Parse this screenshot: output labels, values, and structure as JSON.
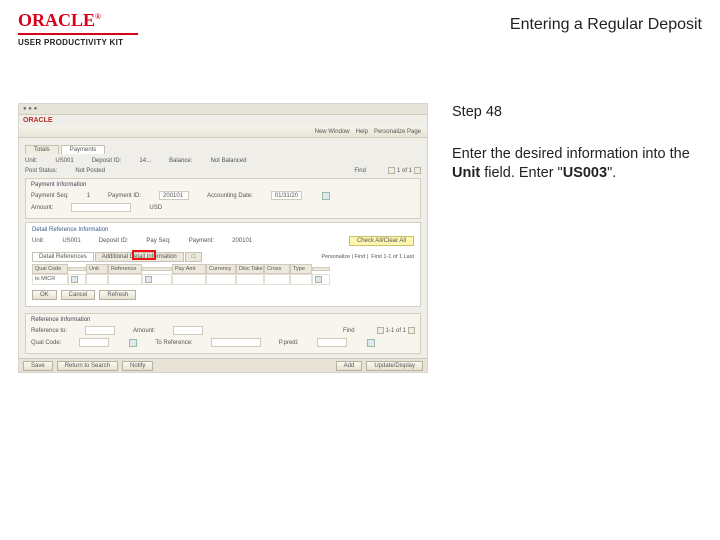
{
  "header": {
    "brand": "ORACLE",
    "tm": "®",
    "subbrand": "USER PRODUCTIVITY KIT",
    "title": "Entering a Regular Deposit"
  },
  "step": {
    "label": "Step 48"
  },
  "instruction": {
    "pre": "Enter the desired information into the ",
    "bold1": "Unit",
    "mid": " field. Enter \"",
    "bold2": "US003",
    "post": "\"."
  },
  "screenshot": {
    "app_logo": "ORACLE",
    "menubar_right": {
      "a": "New Window",
      "b": "Help",
      "c": "Personalize Page"
    },
    "tabs": {
      "totals": "Totals",
      "payments": "Payments"
    },
    "row1": {
      "unit_lbl": "Unit:",
      "unit_val": "US001",
      "dep_lbl": "Deposit ID:",
      "dep_val": "14...",
      "bal_lbl": "Balance:",
      "bal_val": "Not Balanced"
    },
    "row2": {
      "date_lbl": "Post Status:",
      "date_val": "Not Posted",
      "page_lbl": "Find",
      "pager": "1 of 1"
    },
    "panel1_hdr": "Payment Information",
    "panel1": {
      "pay_lbl": "Payment Seq:",
      "pay_val": "1",
      "payid_lbl": "Payment ID:",
      "payid_val": "200101",
      "acc_lbl": "Accounting Date:",
      "acc_val": "01/31/20"
    },
    "panel1b": {
      "amt_lbl": "Amount:",
      "cur": "USD"
    },
    "white_title": "Detail Reference Information",
    "white_row": {
      "unit_lbl": "Unit:",
      "unit_val": "US001",
      "dep_lbl": "Deposit ID:",
      "payseq_lbl": "Pay Seq:",
      "payid_lbl": "Payment:",
      "payid_val": "200101"
    },
    "white_btn": "Check All/Clear All",
    "grouptabs": {
      "a": "Detail References",
      "b": "Additional Detail Information",
      "c": "□"
    },
    "gridnav": {
      "label": "Personalize | Find |",
      "pager": "First 1-1 of 1 Last"
    },
    "grid_head": [
      "Qual Code",
      "",
      "Unit",
      "Reference",
      "",
      "Pay Amt",
      "Currency",
      "Disc Taken",
      "Cross",
      "Type",
      ""
    ],
    "grid_row": [
      "to MICR",
      "",
      "",
      "",
      "",
      "",
      "",
      "",
      "",
      "",
      ""
    ],
    "btns": {
      "ok": "OK",
      "cancel": "Cancel",
      "refresh": "Refresh"
    },
    "low_hdr": "Reference Information",
    "low_row": {
      "to_lbl": "Reference to:",
      "amt_lbl": "Amount:",
      "pager_lbl": "Find",
      "pager": "1-1 of 1"
    },
    "low_row2": {
      "qual_lbl": "Qual Code:",
      "to_ref_lbl": "To Reference:",
      "ppred_lbl": "P.predi:"
    },
    "footer": {
      "save": "Save",
      "return": "Return to Search",
      "notify": "Notify",
      "add": "Add",
      "update": "Update/Display"
    }
  }
}
